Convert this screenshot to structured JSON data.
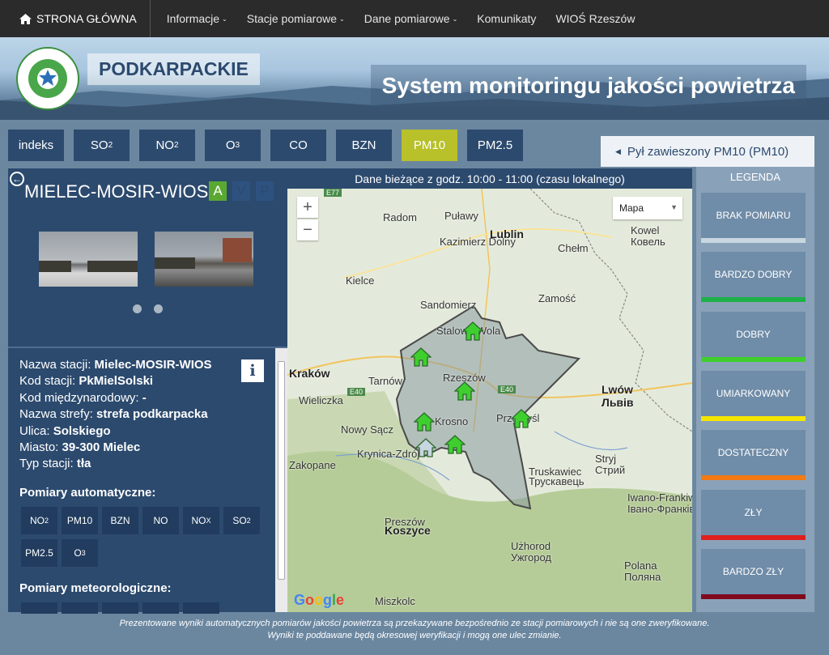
{
  "nav": {
    "home_label": "STRONA GŁÓWNA",
    "items": [
      {
        "label": "Informacje",
        "caret": true
      },
      {
        "label": "Stacje pomiarowe",
        "caret": true
      },
      {
        "label": "Dane pomiarowe",
        "caret": true
      },
      {
        "label": "Komunikaty",
        "caret": false
      },
      {
        "label": "WIOŚ Rzeszów",
        "caret": false
      }
    ]
  },
  "header": {
    "region": "PODKARPACKIE",
    "title": "System monitoringu jakości powietrza",
    "logo_text": "Wojewódzki Inspektorat Ochrony Środowiska Rzeszów"
  },
  "tabs": [
    {
      "label": "indeks",
      "sub": "",
      "active": false
    },
    {
      "label": "SO",
      "sub": "2",
      "active": false
    },
    {
      "label": "NO",
      "sub": "2",
      "active": false
    },
    {
      "label": "O",
      "sub": "3",
      "active": false
    },
    {
      "label": "CO",
      "sub": "",
      "active": false
    },
    {
      "label": "BZN",
      "sub": "",
      "active": false
    },
    {
      "label": "PM10",
      "sub": "",
      "active": true
    },
    {
      "label": "PM2.5",
      "sub": "",
      "active": false
    }
  ],
  "pollutant_title": "Pył zawieszony PM10 (PM10)",
  "legend": {
    "title": "LEGENDA",
    "items": [
      {
        "label": "BRAK POMIARU",
        "color": "#c8d6e0"
      },
      {
        "label": "BARDZO DOBRY",
        "color": "#1fb04a"
      },
      {
        "label": "DOBRY",
        "color": "#3ecf2e"
      },
      {
        "label": "UMIARKOWANY",
        "color": "#f4e600"
      },
      {
        "label": "DOSTATECZNY",
        "color": "#f37a14"
      },
      {
        "label": "ZŁY",
        "color": "#e0201d"
      },
      {
        "label": "BARDZO ZŁY",
        "color": "#7f0a1c"
      }
    ]
  },
  "station": {
    "name": "MIELEC-MOSIR-WIOS",
    "mode_a": "A",
    "mode_v": "V",
    "mode_p": "P",
    "fields": [
      {
        "label": "Nazwa stacji:",
        "value": "Mielec-MOSIR-WIOS"
      },
      {
        "label": "Kod stacji:",
        "value": "PkMielSolski"
      },
      {
        "label": "Kod międzynarodowy:",
        "value": "-"
      },
      {
        "label": "Nazwa strefy:",
        "value": "strefa podkarpacka"
      },
      {
        "label": "Ulica:",
        "value": "Solskiego"
      },
      {
        "label": "Miasto:",
        "value": "39-300 Mielec"
      },
      {
        "label": "Typ stacji:",
        "value": "tła"
      }
    ],
    "auto_title": "Pomiary automatyczne:",
    "auto_measurements": [
      {
        "label": "NO",
        "sub": "2"
      },
      {
        "label": "PM10",
        "sub": ""
      },
      {
        "label": "BZN",
        "sub": ""
      },
      {
        "label": "NO",
        "sub": ""
      },
      {
        "label": "NO",
        "sub": "X"
      },
      {
        "label": "SO",
        "sub": "2"
      },
      {
        "label": "PM2.5",
        "sub": ""
      },
      {
        "label": "O",
        "sub": "3"
      }
    ],
    "meteo_title": "Pomiary meteorologiczne:"
  },
  "map": {
    "header": "Dane bieżące z godz. 10:00 - 11:00 (czasu lokalnego)",
    "type_label": "Mapa",
    "zoom_in": "+",
    "zoom_out": "−",
    "google": "Google",
    "cities": [
      {
        "name": "Radom",
        "big": false
      },
      {
        "name": "Puławy",
        "big": false
      },
      {
        "name": "Kazimierz Dolny",
        "big": false
      },
      {
        "name": "Lublin",
        "big": true
      },
      {
        "name": "Chełm",
        "big": false
      },
      {
        "name": "Kowel",
        "big": false
      },
      {
        "name": "Ковель",
        "big": false
      },
      {
        "name": "Kielce",
        "big": false
      },
      {
        "name": "Sandomierz",
        "big": false
      },
      {
        "name": "Zamość",
        "big": false
      },
      {
        "name": "Stalowa Wola",
        "big": false
      },
      {
        "name": "Kraków",
        "big": true
      },
      {
        "name": "Tarnów",
        "big": false
      },
      {
        "name": "Rzeszów",
        "big": false
      },
      {
        "name": "Wieliczka",
        "big": false
      },
      {
        "name": "Lwów",
        "big": true
      },
      {
        "name": "Львів",
        "big": true
      },
      {
        "name": "Nowy Sącz",
        "big": false
      },
      {
        "name": "Krosno",
        "big": false
      },
      {
        "name": "Przemyśl",
        "big": false
      },
      {
        "name": "Krynica-Zdrój",
        "big": false
      },
      {
        "name": "Zakopane",
        "big": false
      },
      {
        "name": "Truskawiec",
        "big": false
      },
      {
        "name": "Трускавець",
        "big": false
      },
      {
        "name": "Stryj",
        "big": false
      },
      {
        "name": "Стрий",
        "big": false
      },
      {
        "name": "Preszów",
        "big": false
      },
      {
        "name": "Iwano-Frankiwsk",
        "big": false
      },
      {
        "name": "Івано-Франківськ",
        "big": false
      },
      {
        "name": "Koszyce",
        "big": true
      },
      {
        "name": "Użhorod",
        "big": false
      },
      {
        "name": "Ужгород",
        "big": false
      },
      {
        "name": "Miszkolc",
        "big": false
      },
      {
        "name": "Polana",
        "big": false
      },
      {
        "name": "Поляна",
        "big": false
      },
      {
        "name": "E40",
        "big": false
      },
      {
        "name": "E40",
        "big": false
      },
      {
        "name": "E77",
        "big": false
      }
    ],
    "station_markers": [
      {
        "status": "good"
      },
      {
        "status": "good"
      },
      {
        "status": "good"
      },
      {
        "status": "good"
      },
      {
        "status": "good"
      },
      {
        "status": "good"
      },
      {
        "status": "no-data"
      }
    ]
  },
  "footer": {
    "line1": "Prezentowane wyniki automatycznych pomiarów jakości powietrza są przekazywane bezpośrednio ze stacji pomiarowych i nie są one zweryfikowane.",
    "line2": "Wyniki te poddawane będą okresowej weryfikacji i mogą one ulec zmianie."
  }
}
